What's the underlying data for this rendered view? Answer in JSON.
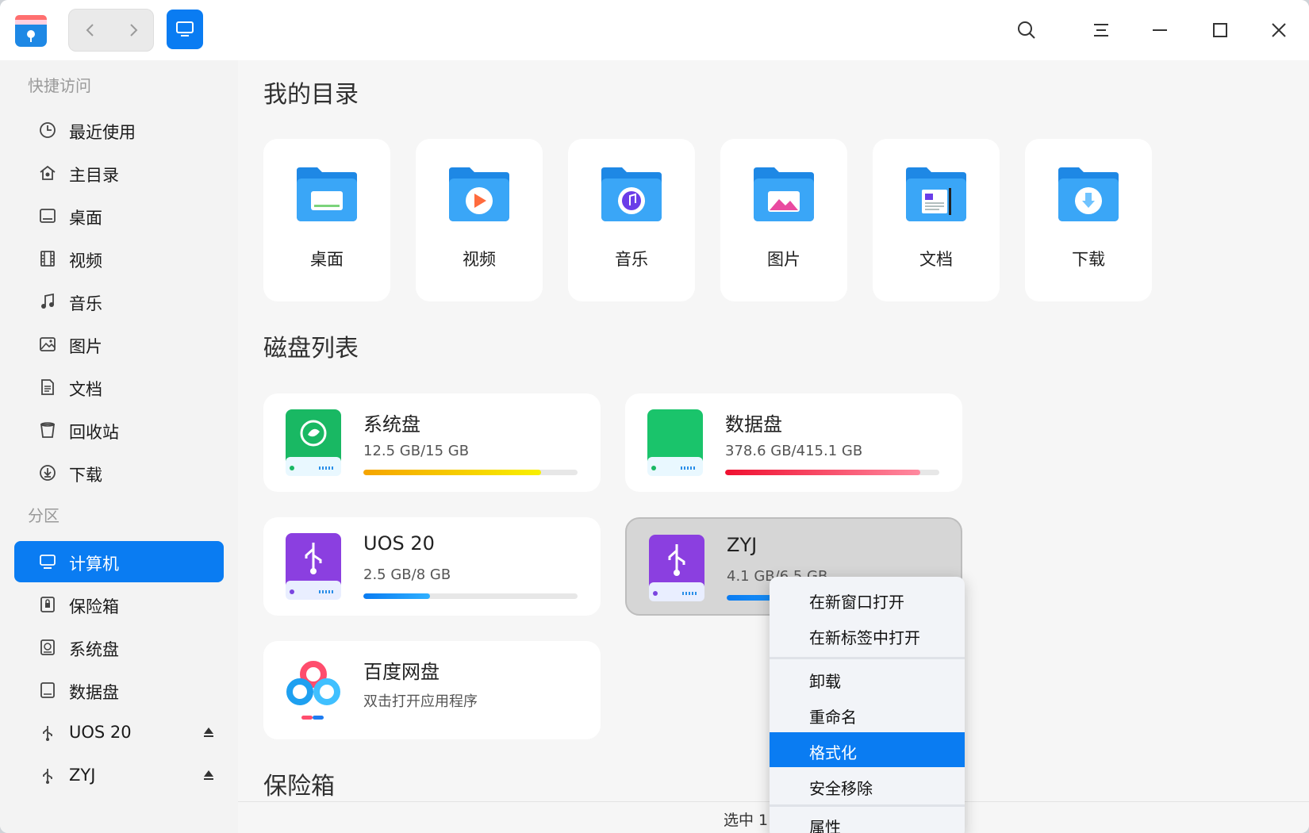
{
  "colors": {
    "accent": "#0a7cf2",
    "system_bar": "#f5b800",
    "data_bar": "#f01845",
    "uos_bar": "#0a84ff",
    "zyj_bar": "#0a84ff"
  },
  "sidebar": {
    "quick_title": "快捷访问",
    "quick_items": [
      {
        "label": "最近使用",
        "icon": "clock-icon"
      },
      {
        "label": "主目录",
        "icon": "home-icon"
      },
      {
        "label": "桌面",
        "icon": "desktop-icon"
      },
      {
        "label": "视频",
        "icon": "video-icon"
      },
      {
        "label": "音乐",
        "icon": "music-icon"
      },
      {
        "label": "图片",
        "icon": "image-icon"
      },
      {
        "label": "文档",
        "icon": "document-icon"
      },
      {
        "label": "回收站",
        "icon": "trash-icon"
      },
      {
        "label": "下载",
        "icon": "download-icon"
      }
    ],
    "partition_title": "分区",
    "partition_items": [
      {
        "label": "计算机",
        "icon": "computer-icon",
        "active": true
      },
      {
        "label": "保险箱",
        "icon": "vault-icon"
      },
      {
        "label": "系统盘",
        "icon": "system-disk-icon"
      },
      {
        "label": "数据盘",
        "icon": "data-disk-icon"
      },
      {
        "label": "UOS 20",
        "icon": "usb-icon",
        "eject": true
      },
      {
        "label": "ZYJ",
        "icon": "usb-icon",
        "eject": true
      }
    ]
  },
  "main": {
    "dirs_title": "我的目录",
    "dirs": [
      {
        "label": "桌面",
        "icon": "desktop-folder-icon"
      },
      {
        "label": "视频",
        "icon": "video-folder-icon"
      },
      {
        "label": "音乐",
        "icon": "music-folder-icon"
      },
      {
        "label": "图片",
        "icon": "picture-folder-icon"
      },
      {
        "label": "文档",
        "icon": "document-folder-icon"
      },
      {
        "label": "下载",
        "icon": "download-folder-icon"
      }
    ],
    "disks_title": "磁盘列表",
    "disks": [
      {
        "name": "系统盘",
        "size": "12.5 GB/15 GB",
        "usage": 0.83
      },
      {
        "name": "数据盘",
        "size": "378.6 GB/415.1 GB",
        "usage": 0.91
      },
      {
        "name": "UOS 20",
        "size": "2.5 GB/8 GB",
        "usage": 0.31
      },
      {
        "name": "ZYJ",
        "size": "4.1 GB/6.5 GB",
        "usage": 0.63
      },
      {
        "name": "百度网盘",
        "size": "双击打开应用程序"
      }
    ],
    "vault_title": "保险箱"
  },
  "status": {
    "text": "选中 1"
  },
  "context_menu": {
    "items": [
      "在新窗口打开",
      "在新标签中打开",
      "卸载",
      "重命名",
      "格式化",
      "安全移除",
      "属性"
    ],
    "highlighted": "格式化"
  }
}
